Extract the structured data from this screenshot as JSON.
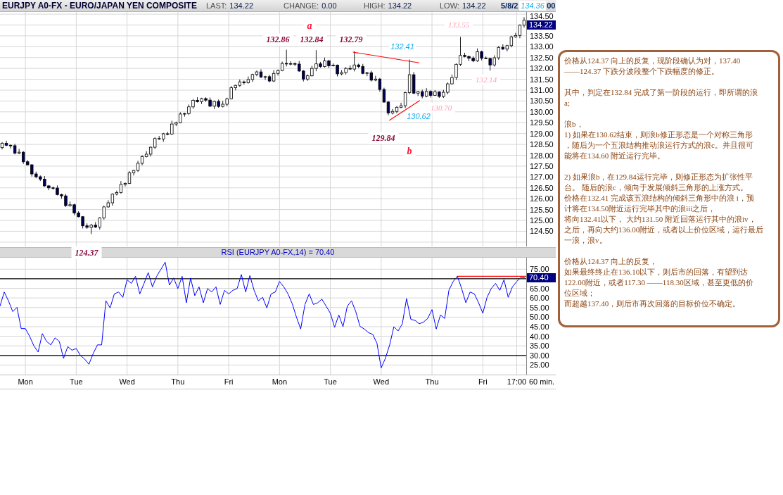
{
  "header": {
    "title": "EURJPY A0-FX - EURO/JAPAN YEN COMPOSITE",
    "stats": [
      {
        "label": "LAST:",
        "value": "134.22"
      },
      {
        "label": "CHANGE:",
        "value": "0.00"
      },
      {
        "label": "HIGH:",
        "value": "134.22"
      },
      {
        "label": "LOW:",
        "value": "134.22"
      }
    ],
    "timestamp_parts": [
      "5/8/2",
      ":00"
    ]
  },
  "price_chart": {
    "last_price_tag": "134.22",
    "chart_data": {
      "type": "candlestick",
      "grid": true,
      "ylim": [
        123.8,
        134.6
      ],
      "yticks": [
        {
          "value": 134.5,
          "label": "134.50"
        },
        {
          "value": 133.5,
          "label": "133.50"
        },
        {
          "value": 133,
          "label": "133.00"
        },
        {
          "value": 132.5,
          "label": "132.50"
        },
        {
          "value": 132,
          "label": "132.00"
        },
        {
          "value": 131.5,
          "label": "131.50"
        },
        {
          "value": 131,
          "label": "131.00"
        },
        {
          "value": 130.5,
          "label": "130.50"
        },
        {
          "value": 130,
          "label": "130.00"
        },
        {
          "value": 129.5,
          "label": "129.50"
        },
        {
          "value": 129,
          "label": "129.00"
        },
        {
          "value": 128.5,
          "label": "128.50"
        },
        {
          "value": 128,
          "label": "128.00"
        },
        {
          "value": 127.5,
          "label": "127.50"
        },
        {
          "value": 127,
          "label": "127.00"
        },
        {
          "value": 126.5,
          "label": "126.50"
        },
        {
          "value": 126,
          "label": "126.00"
        },
        {
          "value": 125.5,
          "label": "125.50"
        },
        {
          "value": 125,
          "label": "125.00"
        },
        {
          "value": 124.5,
          "label": "124.50"
        }
      ],
      "categories": [
        null,
        null,
        null,
        null,
        null,
        null,
        null,
        null,
        null,
        null,
        null,
        null,
        null,
        null,
        null,
        null,
        null,
        null,
        null,
        null,
        null,
        null,
        null,
        null,
        null,
        null,
        null,
        null,
        null,
        null,
        null,
        null,
        null,
        null,
        null,
        null,
        null,
        null,
        null,
        null,
        null,
        null,
        null,
        null,
        null,
        null,
        null,
        null,
        null,
        null,
        null,
        null,
        null,
        null,
        null,
        null,
        null,
        null,
        null,
        null,
        null,
        null,
        null,
        null,
        null,
        null,
        null,
        null,
        null,
        null,
        null,
        null,
        null,
        null,
        null,
        null,
        null,
        null,
        null,
        null,
        null,
        null,
        null,
        null,
        null,
        null,
        null,
        null,
        null,
        null,
        null,
        null,
        null,
        null,
        null,
        null,
        null,
        null,
        null,
        null,
        null,
        null,
        null,
        null,
        null,
        null,
        null,
        null,
        null,
        null,
        null,
        null,
        null,
        null,
        null,
        null,
        null,
        null,
        null,
        null,
        null,
        null,
        null,
        null
      ],
      "ohlc": [
        [
          128.35,
          128.61,
          128.27,
          128.55
        ],
        [
          128.55,
          128.67,
          128.42,
          128.46
        ],
        [
          128.46,
          128.5,
          128.31,
          128.44
        ],
        [
          128.44,
          128.53,
          128.04,
          128.1
        ],
        [
          128.1,
          128.29,
          128.05,
          128.14
        ],
        [
          128.14,
          128.19,
          127.6,
          127.7
        ],
        [
          127.7,
          127.78,
          127.53,
          127.56
        ],
        [
          127.56,
          127.59,
          127.02,
          127.14
        ],
        [
          127.14,
          127.25,
          126.94,
          127.01
        ],
        [
          127.01,
          127.07,
          126.81,
          126.9
        ],
        [
          126.9,
          127.04,
          126.55,
          126.59
        ],
        [
          126.59,
          126.63,
          126.39,
          126.5
        ],
        [
          126.5,
          126.56,
          126.41,
          126.49
        ],
        [
          126.49,
          126.61,
          126.15,
          126.19
        ],
        [
          126.19,
          126.23,
          126,
          126.13
        ],
        [
          126.13,
          126.22,
          125.62,
          125.68
        ],
        [
          125.68,
          125.87,
          125.63,
          125.72
        ],
        [
          125.72,
          125.77,
          125.24,
          125.34
        ],
        [
          125.34,
          125.42,
          125.14,
          125.17
        ],
        [
          125.17,
          125.2,
          124.63,
          124.75
        ],
        [
          124.75,
          124.86,
          124.61,
          124.68
        ],
        [
          124.68,
          124.84,
          124.37,
          124.78
        ],
        [
          124.78,
          124.92,
          124.65,
          124.69
        ],
        [
          124.69,
          125.15,
          124.58,
          125.11
        ],
        [
          125.11,
          125.68,
          125.03,
          125.62
        ],
        [
          125.62,
          125.93,
          125.58,
          125.81
        ],
        [
          125.81,
          126.25,
          125.68,
          126.21
        ],
        [
          126.21,
          126.37,
          126.15,
          126.28
        ],
        [
          126.28,
          126.81,
          126.23,
          126.66
        ],
        [
          126.66,
          126.75,
          126.56,
          126.7
        ],
        [
          126.7,
          127.27,
          126.67,
          127.19
        ],
        [
          127.19,
          127.33,
          127.07,
          127.3
        ],
        [
          127.3,
          127.74,
          127.23,
          127.63
        ],
        [
          127.63,
          128,
          127.54,
          127.94
        ],
        [
          127.94,
          128.19,
          127.9,
          128.05
        ],
        [
          128.05,
          128.41,
          127.94,
          128.37
        ],
        [
          128.37,
          128.83,
          128.29,
          128.77
        ],
        [
          128.77,
          128.89,
          128.71,
          128.75
        ],
        [
          128.75,
          129.03,
          128.62,
          128.99
        ],
        [
          128.99,
          129.08,
          128.92,
          128.98
        ],
        [
          128.98,
          129.59,
          128.93,
          129.44
        ],
        [
          129.44,
          129.55,
          129.34,
          129.5
        ],
        [
          129.5,
          129.98,
          129.47,
          129.9
        ],
        [
          129.9,
          129.95,
          129.78,
          129.92
        ],
        [
          129.92,
          130.34,
          129.85,
          130.23
        ],
        [
          130.23,
          130.59,
          130.14,
          130.53
        ],
        [
          130.53,
          130.67,
          130.43,
          130.47
        ],
        [
          130.47,
          130.65,
          130.36,
          130.61
        ],
        [
          130.61,
          130.67,
          130.46,
          130.54
        ],
        [
          130.54,
          130.66,
          130.22,
          130.26
        ],
        [
          130.26,
          130.52,
          130.13,
          130.48
        ],
        [
          130.48,
          130.57,
          130.19,
          130.25
        ],
        [
          130.25,
          130.5,
          130.2,
          130.35
        ],
        [
          130.35,
          130.65,
          130.25,
          130.6
        ],
        [
          130.6,
          131.19,
          130.57,
          131.11
        ],
        [
          131.11,
          131.25,
          130.99,
          131.22
        ],
        [
          131.22,
          131.49,
          131.15,
          131.38
        ],
        [
          131.38,
          131.44,
          131.25,
          131.34
        ],
        [
          131.34,
          131.63,
          131.3,
          131.49
        ],
        [
          131.49,
          131.76,
          131.38,
          131.72
        ],
        [
          131.72,
          131.9,
          131.64,
          131.84
        ],
        [
          131.84,
          131.96,
          131.56,
          131.6
        ],
        [
          131.6,
          131.66,
          131.47,
          131.62
        ],
        [
          131.62,
          131.71,
          131.36,
          131.42
        ],
        [
          131.42,
          131.92,
          131.37,
          131.77
        ],
        [
          131.77,
          131.95,
          131.67,
          131.9
        ],
        [
          131.9,
          132.31,
          131.87,
          132.23
        ],
        [
          132.23,
          132.86,
          132.09,
          132.21
        ],
        [
          132.21,
          132.33,
          132.14,
          132.22
        ],
        [
          132.22,
          132.28,
          132.11,
          132.2
        ],
        [
          132.2,
          132.34,
          131.84,
          131.88
        ],
        [
          131.88,
          131.92,
          131.4,
          131.51
        ],
        [
          131.51,
          131.72,
          131.43,
          131.66
        ],
        [
          131.66,
          132.12,
          131.62,
          132
        ],
        [
          132,
          132.84,
          131.87,
          132.21
        ],
        [
          132.21,
          132.3,
          132.03,
          132.09
        ],
        [
          132.09,
          132.5,
          132.04,
          132.35
        ],
        [
          132.35,
          132.4,
          132.02,
          132.12
        ],
        [
          132.12,
          132.23,
          132.09,
          132.15
        ],
        [
          132.15,
          132.18,
          131.63,
          131.75
        ],
        [
          131.75,
          131.92,
          131.68,
          131.81
        ],
        [
          131.81,
          132.06,
          131.72,
          132
        ],
        [
          132,
          132.14,
          131.93,
          131.97
        ],
        [
          131.97,
          132.79,
          131.86,
          132.16
        ],
        [
          132.16,
          132.22,
          132.01,
          132.09
        ],
        [
          132.09,
          132.21,
          131.73,
          131.77
        ],
        [
          131.77,
          131.84,
          131.64,
          131.8
        ],
        [
          131.8,
          131.89,
          131.4,
          131.46
        ],
        [
          131.46,
          131.66,
          131.41,
          131.51
        ],
        [
          131.51,
          131.56,
          130.93,
          131.03
        ],
        [
          131.03,
          131.11,
          130.42,
          130.45
        ],
        [
          130.45,
          130.5,
          129.84,
          129.95
        ],
        [
          129.95,
          130.13,
          129.88,
          130.02
        ],
        [
          130.02,
          130.27,
          129.93,
          130.21
        ],
        [
          130.21,
          130.42,
          130.17,
          130.28
        ],
        [
          130.28,
          130.93,
          130.17,
          130.89
        ],
        [
          130.89,
          132.41,
          130.81,
          131.71
        ],
        [
          131.71,
          131.83,
          130.82,
          130.86
        ],
        [
          130.86,
          130.97,
          130.73,
          130.93
        ],
        [
          130.93,
          131.02,
          130.62,
          130.72
        ],
        [
          130.72,
          131.09,
          130.67,
          130.94
        ],
        [
          130.94,
          130.99,
          130.66,
          130.76
        ],
        [
          130.76,
          131,
          130.73,
          130.92
        ],
        [
          130.92,
          130.95,
          130.64,
          130.71
        ],
        [
          130.71,
          131.01,
          130.64,
          130.9
        ],
        [
          130.9,
          131.35,
          130.81,
          131.29
        ],
        [
          131.29,
          131.72,
          131.25,
          131.58
        ],
        [
          131.58,
          132.23,
          131.47,
          132.19
        ],
        [
          132.19,
          133.45,
          132.11,
          132.6
        ],
        [
          132.6,
          132.72,
          132.51,
          132.55
        ],
        [
          132.55,
          132.59,
          132.34,
          132.47
        ],
        [
          132.47,
          132.56,
          132.29,
          132.35
        ],
        [
          132.35,
          132.92,
          132.3,
          132.77
        ],
        [
          132.77,
          132.82,
          132.37,
          132.47
        ],
        [
          132.47,
          132.55,
          132.43,
          132.46
        ],
        [
          132.46,
          132.49,
          131.9,
          132.16
        ],
        [
          132.16,
          132.6,
          132.09,
          132.49
        ],
        [
          132.49,
          133.03,
          132.4,
          132.97
        ],
        [
          132.97,
          133.11,
          132.85,
          132.89
        ],
        [
          132.89,
          133.09,
          132.78,
          133.05
        ],
        [
          133.05,
          133.51,
          132.97,
          133.45
        ],
        [
          133.45,
          133.64,
          133.41,
          133.52
        ],
        [
          133.52,
          134.03,
          133.39,
          133.99
        ],
        [
          133.99,
          134.36,
          133.88,
          134.22
        ]
      ]
    },
    "annotations": [
      {
        "text": "134.36",
        "kind": "blue"
      },
      {
        "text": "a",
        "kind": "wave"
      },
      {
        "text": "133.55",
        "kind": "pink"
      },
      {
        "text": "132.86",
        "kind": "peak"
      },
      {
        "text": "132.84",
        "kind": "peak"
      },
      {
        "text": "132.79",
        "kind": "peak"
      },
      {
        "text": "132.41",
        "kind": "blue"
      },
      {
        "text": "132.14",
        "kind": "pink"
      },
      {
        "text": "130.70",
        "kind": "pink"
      },
      {
        "text": "130.62",
        "kind": "blue"
      },
      {
        "text": "129.84",
        "kind": "peak"
      },
      {
        "text": "b",
        "kind": "wave"
      },
      {
        "text": "124.37",
        "kind": "peak"
      }
    ]
  },
  "rsi_panel": {
    "value_tag": "70.40",
    "chart_data": {
      "type": "line",
      "grid": true,
      "title": "RSI (EURJPY A0-FX,14) = 70.40",
      "ylim": [
        20,
        81
      ],
      "categories": [
        null,
        null,
        null,
        null,
        null,
        null,
        "Mon",
        null,
        null,
        null,
        null,
        null,
        null,
        null,
        null,
        null,
        null,
        null,
        "Tue",
        null,
        null,
        null,
        null,
        null,
        null,
        null,
        null,
        null,
        null,
        null,
        "Wed",
        null,
        null,
        null,
        null,
        null,
        null,
        null,
        null,
        null,
        null,
        null,
        "Thu",
        null,
        null,
        null,
        null,
        null,
        null,
        null,
        null,
        null,
        null,
        null,
        "Fri",
        null,
        null,
        null,
        null,
        null,
        null,
        null,
        null,
        null,
        null,
        null,
        "Mon",
        null,
        null,
        null,
        null,
        null,
        null,
        null,
        null,
        null,
        null,
        null,
        "Tue",
        null,
        null,
        null,
        null,
        null,
        null,
        null,
        null,
        null,
        null,
        null,
        "Wed",
        null,
        null,
        null,
        null,
        null,
        null,
        null,
        null,
        null,
        null,
        null,
        "Thu",
        null,
        null,
        null,
        null,
        null,
        null,
        null,
        null,
        null,
        null,
        null,
        "Fri",
        null,
        null,
        null,
        null,
        null,
        null,
        null,
        "17:00",
        null,
        null
      ],
      "yticks": [
        {
          "value": 75,
          "label": "75.00"
        },
        {
          "value": 65,
          "label": "65.00"
        },
        {
          "value": 60,
          "label": "60.00"
        },
        {
          "value": 55,
          "label": "55.00"
        },
        {
          "value": 50,
          "label": "50.00"
        },
        {
          "value": 45,
          "label": "45.00"
        },
        {
          "value": 40,
          "label": "40.00"
        },
        {
          "value": 35,
          "label": "35.00"
        },
        {
          "value": 30,
          "label": "30.00"
        },
        {
          "value": 25,
          "label": "25.00"
        }
      ],
      "series": [
        {
          "color": "#0000ff",
          "values": [
            55.7,
            63.1,
            58.5,
            52.9,
            55.1,
            44,
            44,
            40,
            35,
            31.8,
            41.4,
            37.3,
            35.5,
            39.2,
            37.3,
            28.5,
            34.6,
            32.7,
            33.6,
            30,
            28.1,
            25.4,
            30.9,
            35.5,
            35.5,
            58.5,
            54.8,
            62.1,
            63.1,
            60.3,
            69.5,
            67.6,
            71.3,
            62.1,
            67.6,
            73.2,
            65.8,
            71.3,
            75,
            78.7,
            66.7,
            70.4,
            64.9,
            71.3,
            57.5,
            70.4,
            61.2,
            65.8,
            57.5,
            64.9,
            63.1,
            65.8,
            56.6,
            64,
            62.1,
            64,
            64.9,
            72.2,
            63.1,
            71.7,
            64,
            58.5,
            60.3,
            54.8,
            62.1,
            63.1,
            68.6,
            65.8,
            62.1,
            57,
            50,
            43.8,
            56.6,
            62.1,
            56.6,
            57.5,
            59.4,
            55.7,
            52,
            44.7,
            51.1,
            45,
            55.7,
            58.5,
            52.9,
            45.2,
            43.8,
            41.9,
            41,
            36.4,
            23.5,
            28.5,
            35.5,
            45,
            42.8,
            46.5,
            59.7,
            48.8,
            48.3,
            46.5,
            47.4,
            49.3,
            53.9,
            43.8,
            51.1,
            49.3,
            64,
            68.6,
            71.3,
            64.9,
            57.5,
            63.1,
            62.1,
            57.5,
            52,
            60.3,
            64.9,
            67.6,
            64,
            69.5,
            60.3,
            65.8,
            68.6,
            70.8,
            70.4
          ]
        }
      ],
      "ref_lines": [
        {
          "axis": "y",
          "value": 70
        },
        {
          "axis": "y",
          "value": 30
        }
      ]
    }
  },
  "time_axis": {
    "interval": "60 min."
  },
  "commentary": {
    "paragraphs": [
      {
        "lines": [
          "价格从124.37 向上的反复，现阶段确认为对，137.40",
          "——124.37 下跌分波段整个下跌幅度的修正。"
        ]
      },
      {
        "lines": [
          "其中，判定在132.84 完成了第一阶段的运行，即所谓的浪",
          "a;"
        ]
      },
      {
        "lines": [
          "浪b，",
          "1) 如果在130.62结束，则浪b修正形态是一个对称三角形",
          "，随后为一个五浪结构推动浪运行方式的浪c。并且很可",
          "能将在134.60 附近运行完毕。"
        ]
      },
      {
        "lines": [
          "2) 如果浪b，在129.84运行完毕，则修正形态为扩张性平",
          "台。 随后的浪c，倾向于发展倾斜三角形的上涨方式。",
          "价格在132.41 完成该五浪结构的倾斜三角形中的浪 i，预",
          "计将在134.50附近运行完毕其中的浪iii之后，",
          "将向132.41以下， 大约131.50 附近回落运行其中的浪iv，",
          "之后，再向大约136.00附近，或者以上价位区域，运行最后",
          "一浪，浪v。"
        ]
      },
      {
        "lines": [
          "价格从124.37 向上的反复，",
          "如果最终终止在136.10以下，则后市的回落，有望到达",
          "122.00附近，或者117.30 ——118.30区域，甚至更低的价",
          "位区域；",
          "而超越137.40，则后市再次回落的目标价位不确定。"
        ]
      }
    ]
  }
}
